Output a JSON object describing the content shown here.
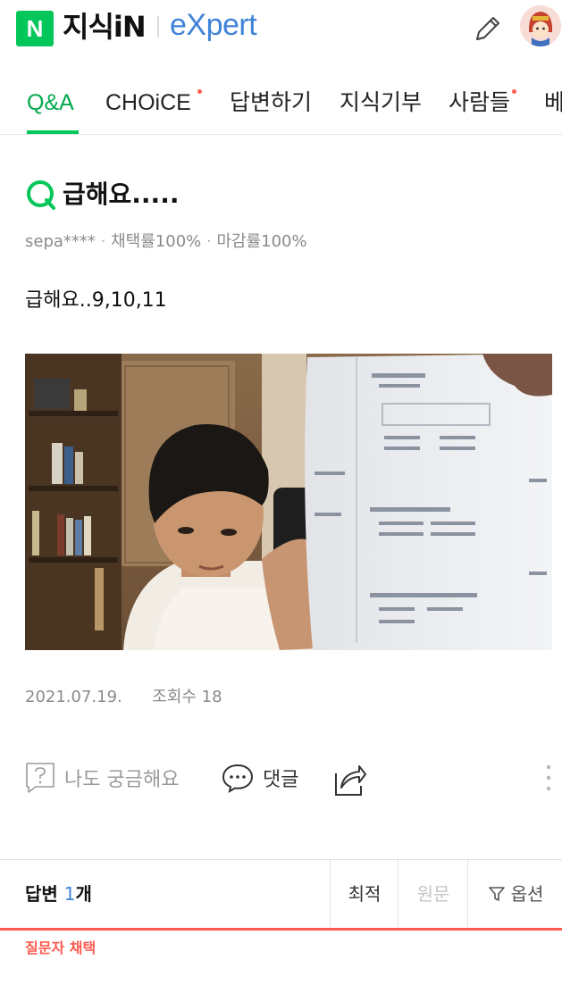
{
  "header": {
    "logo_letter": "N",
    "service_name": "지식iN",
    "partner_brand": "eXpert",
    "write_icon": "pencil-icon",
    "avatar_icon": "profile-avatar"
  },
  "tabs": [
    {
      "label": "Q&A",
      "active": true,
      "new_dot": false
    },
    {
      "label": "CHOiCE",
      "active": false,
      "new_dot": true
    },
    {
      "label": "답변하기",
      "active": false,
      "new_dot": false
    },
    {
      "label": "지식기부",
      "active": false,
      "new_dot": false
    },
    {
      "label": "사람들",
      "active": false,
      "new_dot": true
    },
    {
      "label": "베",
      "active": false,
      "new_dot": false
    }
  ],
  "question": {
    "icon": "q-icon",
    "title": "급해요.....",
    "author": "sepa****",
    "adoption_rate": "채택률100%",
    "closing_rate": "마감률100%",
    "body": "급해요..9,10,11",
    "date": "2021.07.19.",
    "views": "조회수 18"
  },
  "actions": {
    "curious_label": "나도 궁금해요",
    "comment_label": "댓글",
    "share_icon": "share-icon",
    "more_icon": "kebab-menu-icon"
  },
  "answers": {
    "label": "답변",
    "count": "1",
    "unit": "개",
    "sort_latest": "최적",
    "sort_original": "원문",
    "options_label": "옵션",
    "selected_label": "질문자 채택"
  },
  "colors": {
    "brand_green": "#03c75a",
    "expert_blue": "#3f83d8",
    "accent_red": "#ff5a4e"
  }
}
